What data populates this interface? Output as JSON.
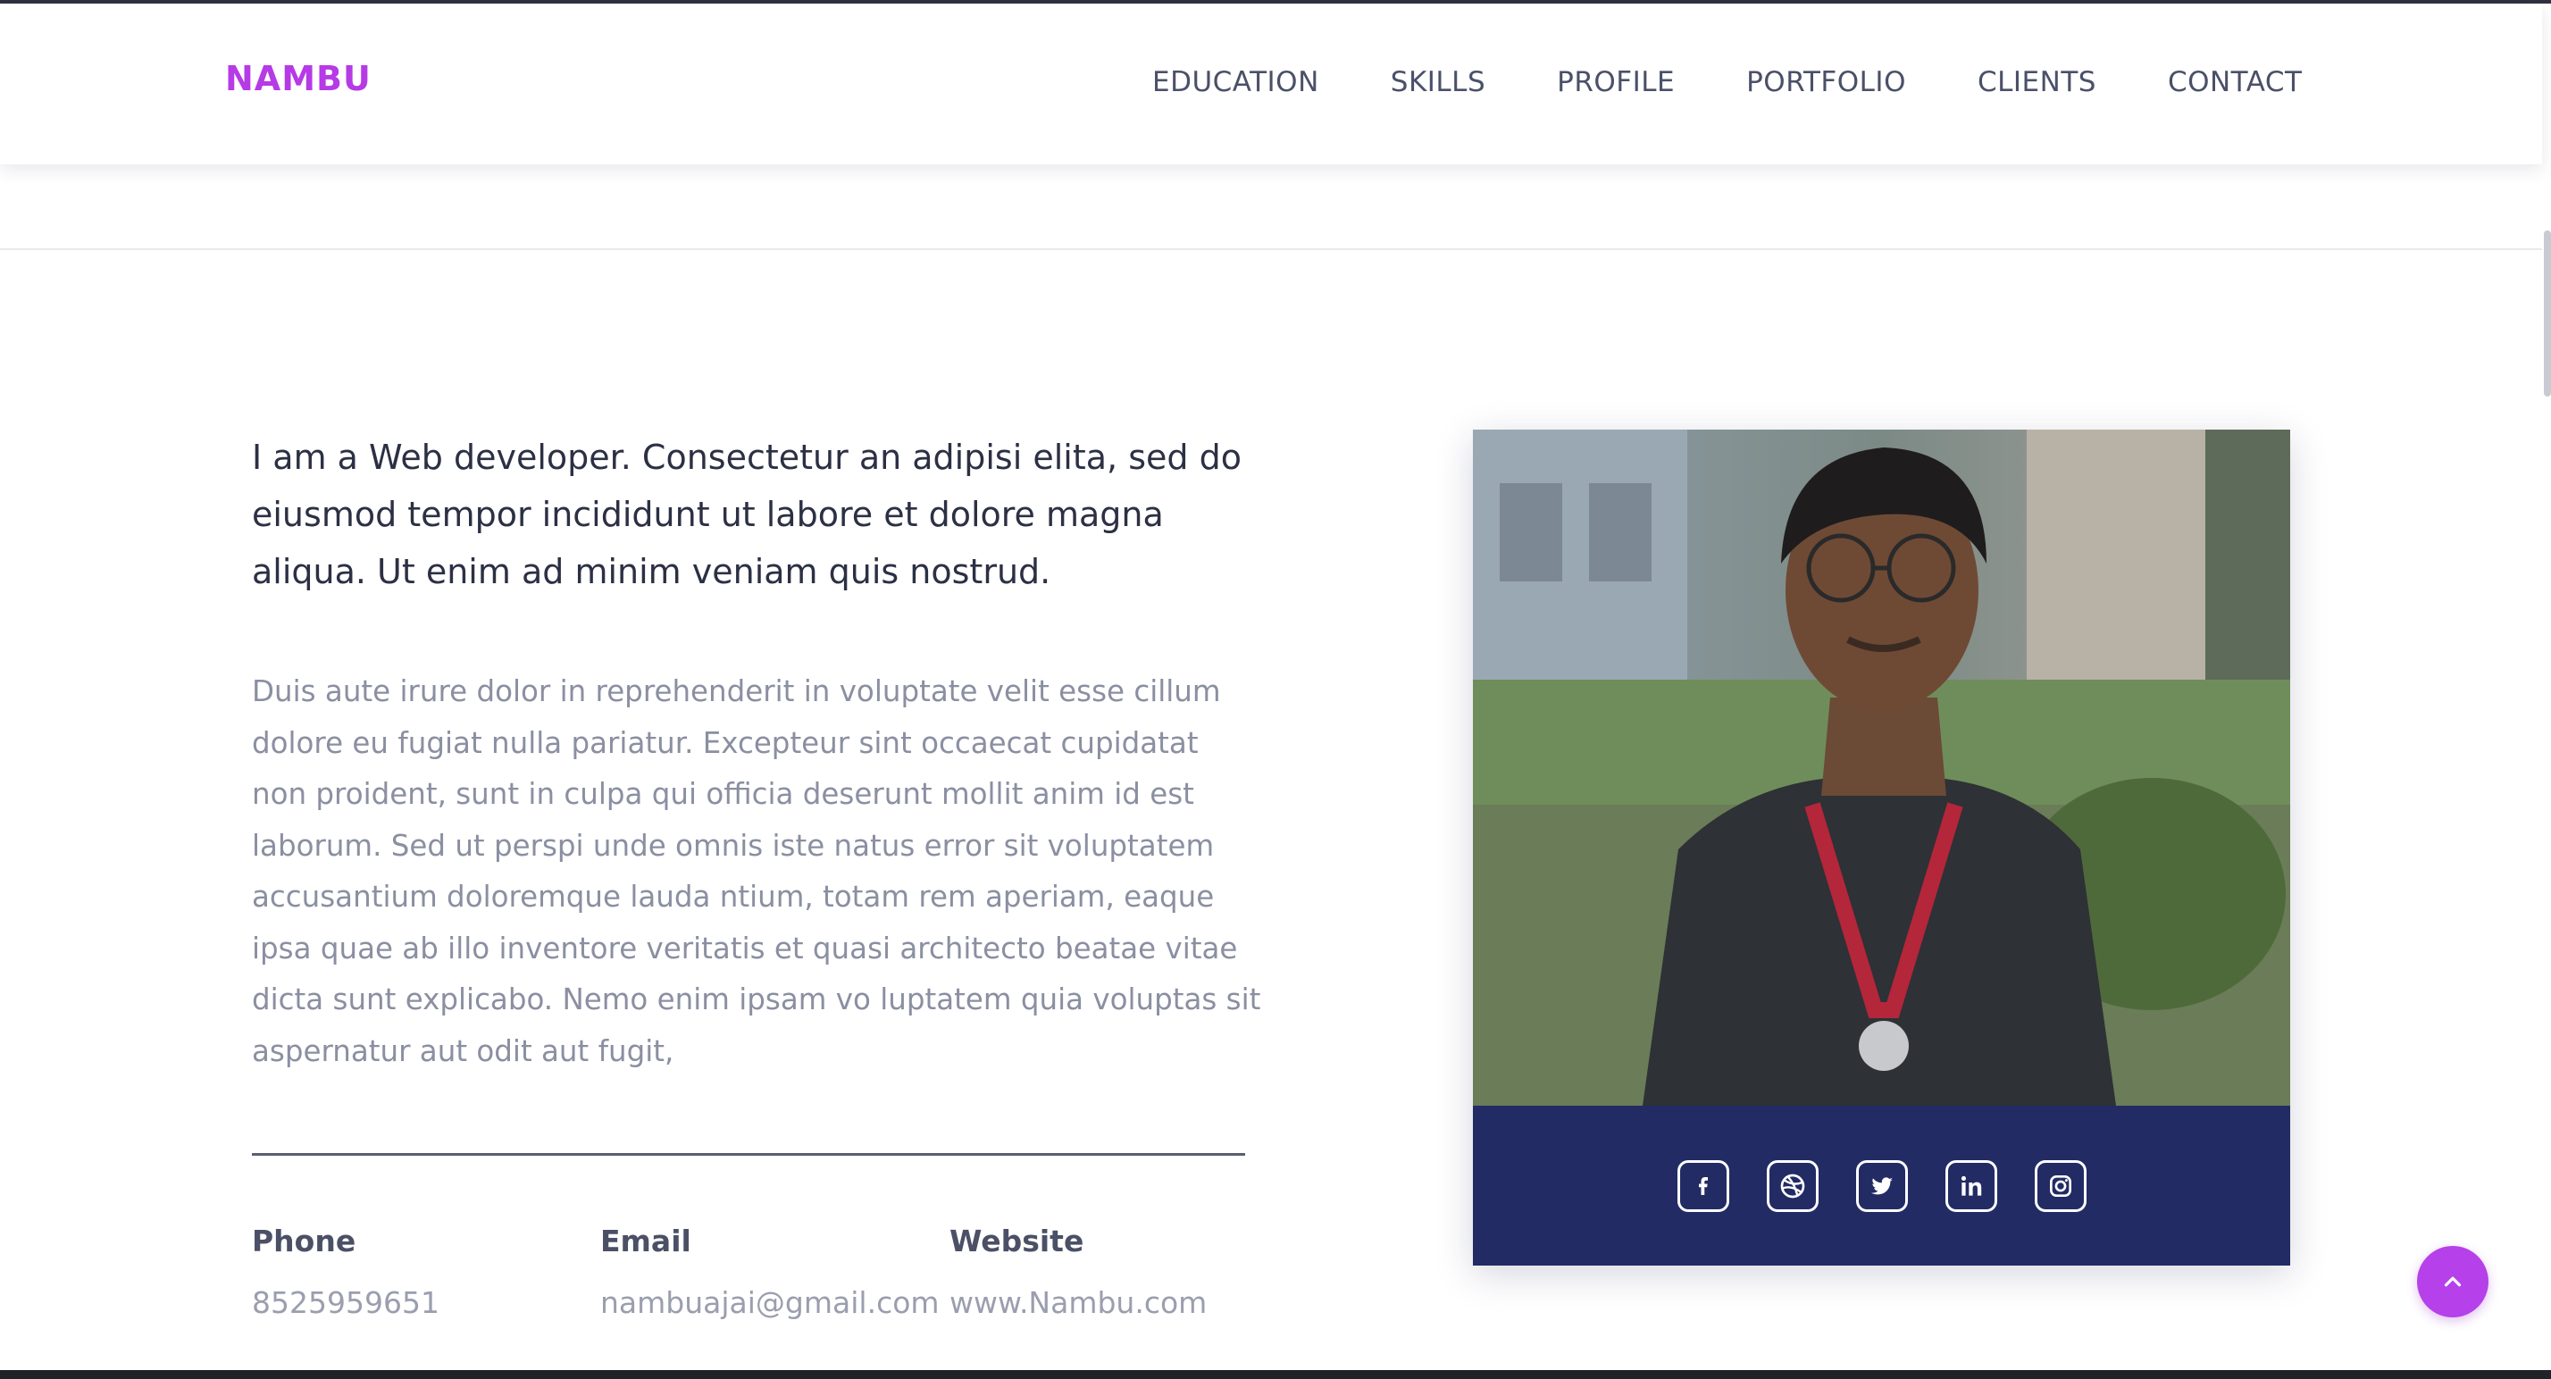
{
  "brand": {
    "name": "NAMBU"
  },
  "nav": {
    "items": [
      {
        "label": "EDUCATION"
      },
      {
        "label": "SKILLS"
      },
      {
        "label": "PROFILE"
      },
      {
        "label": "PORTFOLIO"
      },
      {
        "label": "CLIENTS"
      },
      {
        "label": "CONTACT"
      }
    ]
  },
  "about": {
    "lead": "I am a Web developer. Consectetur an adipisi elita, sed do eiusmod tempor incididunt ut labore et dolore magna aliqua. Ut enim ad minim veniam quis nostrud.",
    "body": "Duis aute irure dolor in reprehenderit in voluptate velit esse cillum dolore eu fugiat nulla pariatur. Excepteur sint occaecat cupidatat non proident, sunt in culpa qui officia deserunt mollit anim id est laborum. Sed ut perspi unde omnis iste natus error sit voluptatem accusantium doloremque lauda ntium, totam rem aperiam, eaque ipsa quae ab illo inventore veritatis et quasi architecto beatae vitae dicta sunt explicabo. Nemo enim ipsam vo luptatem quia voluptas sit aspernatur aut odit aut fugit,"
  },
  "contact": {
    "phone": {
      "label": "Phone",
      "value": "8525959651"
    },
    "email": {
      "label": "Email",
      "value": "nambuajai@gmail.com"
    },
    "website": {
      "label": "Website",
      "value": "www.Nambu.com"
    }
  },
  "social": {
    "icons": [
      "facebook-icon",
      "dribbble-icon",
      "twitter-icon",
      "linkedin-icon",
      "instagram-icon"
    ]
  },
  "colors": {
    "brand": "#b63ae6",
    "social_bar": "#222b64",
    "back_to_top": "#b640ea"
  }
}
